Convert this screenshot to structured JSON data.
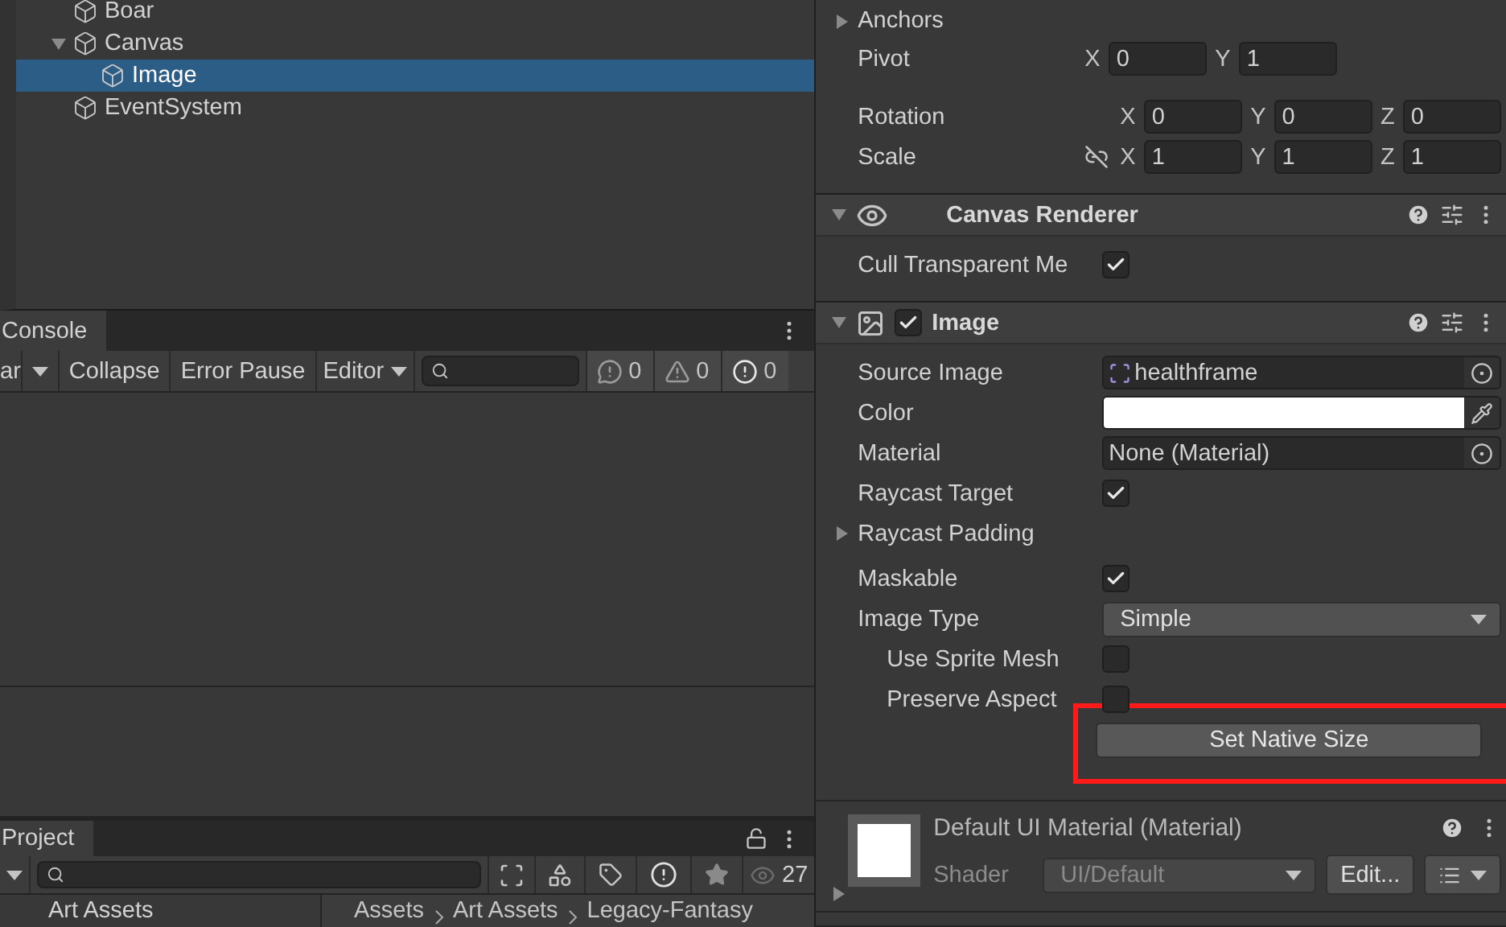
{
  "hierarchy": {
    "items": [
      {
        "name": "Boar",
        "selected": false
      },
      {
        "name": "Canvas",
        "selected": false,
        "expanded": true,
        "children": [
          {
            "name": "Image",
            "selected": true
          }
        ]
      },
      {
        "name": "EventSystem",
        "selected": false
      }
    ]
  },
  "console": {
    "tab": "Console",
    "clear": "ar",
    "collapse": "Collapse",
    "error_pause": "Error Pause",
    "editor": "Editor",
    "counts": [
      {
        "kind": "info",
        "count": "0"
      },
      {
        "kind": "warning",
        "count": "0"
      },
      {
        "kind": "error",
        "count": "0"
      }
    ]
  },
  "project": {
    "tab": "Project",
    "hidden_count": "27",
    "tree": [
      "Art Assets"
    ],
    "breadcrumb": [
      "Assets",
      "Art Assets",
      "Legacy-Fantasy"
    ]
  },
  "inspector": {
    "transform": {
      "anchors": "Anchors",
      "rows": [
        {
          "label": "Pivot",
          "axes": [
            {
              "axis": "X",
              "value": "0"
            },
            {
              "axis": "Y",
              "value": "1"
            }
          ]
        },
        {
          "label": "Rotation",
          "axes": [
            {
              "axis": "X",
              "value": "0"
            },
            {
              "axis": "Y",
              "value": "0"
            },
            {
              "axis": "Z",
              "value": "0"
            }
          ]
        },
        {
          "label": "Scale",
          "linked": false,
          "axes": [
            {
              "axis": "X",
              "value": "1"
            },
            {
              "axis": "Y",
              "value": "1"
            },
            {
              "axis": "Z",
              "value": "1"
            }
          ]
        }
      ]
    },
    "canvas_renderer": {
      "title": "Canvas Renderer",
      "expanded": true,
      "fields": [
        {
          "kind": "checkbox",
          "label": "Cull Transparent Me",
          "checked": true
        }
      ]
    },
    "image": {
      "title": "Image",
      "expanded": true,
      "enabled": true,
      "fields": [
        {
          "kind": "object",
          "label": "Source Image",
          "value": "healthframe",
          "sprite": true
        },
        {
          "kind": "color",
          "label": "Color",
          "color": "#ffffff"
        },
        {
          "kind": "object",
          "label": "Material",
          "value": "None (Material)",
          "sprite": false
        },
        {
          "kind": "checkbox",
          "label": "Raycast Target",
          "checked": true
        },
        {
          "kind": "foldout",
          "label": "Raycast Padding",
          "expanded": false
        },
        {
          "kind": "checkbox",
          "label": "Maskable",
          "checked": true
        },
        {
          "kind": "dropdown",
          "label": "Image Type",
          "value": "Simple"
        },
        {
          "kind": "subcheckbox",
          "label": "Use Sprite Mesh",
          "checked": false
        },
        {
          "kind": "subcheckbox",
          "label": "Preserve Aspect",
          "checked": false
        },
        {
          "kind": "button",
          "label": "Set Native Size",
          "highlighted": true
        }
      ]
    },
    "material": {
      "title": "Default UI Material (Material)",
      "expanded": false,
      "shader_label": "Shader",
      "shader": "UI/Default",
      "edit": "Edit..."
    }
  }
}
